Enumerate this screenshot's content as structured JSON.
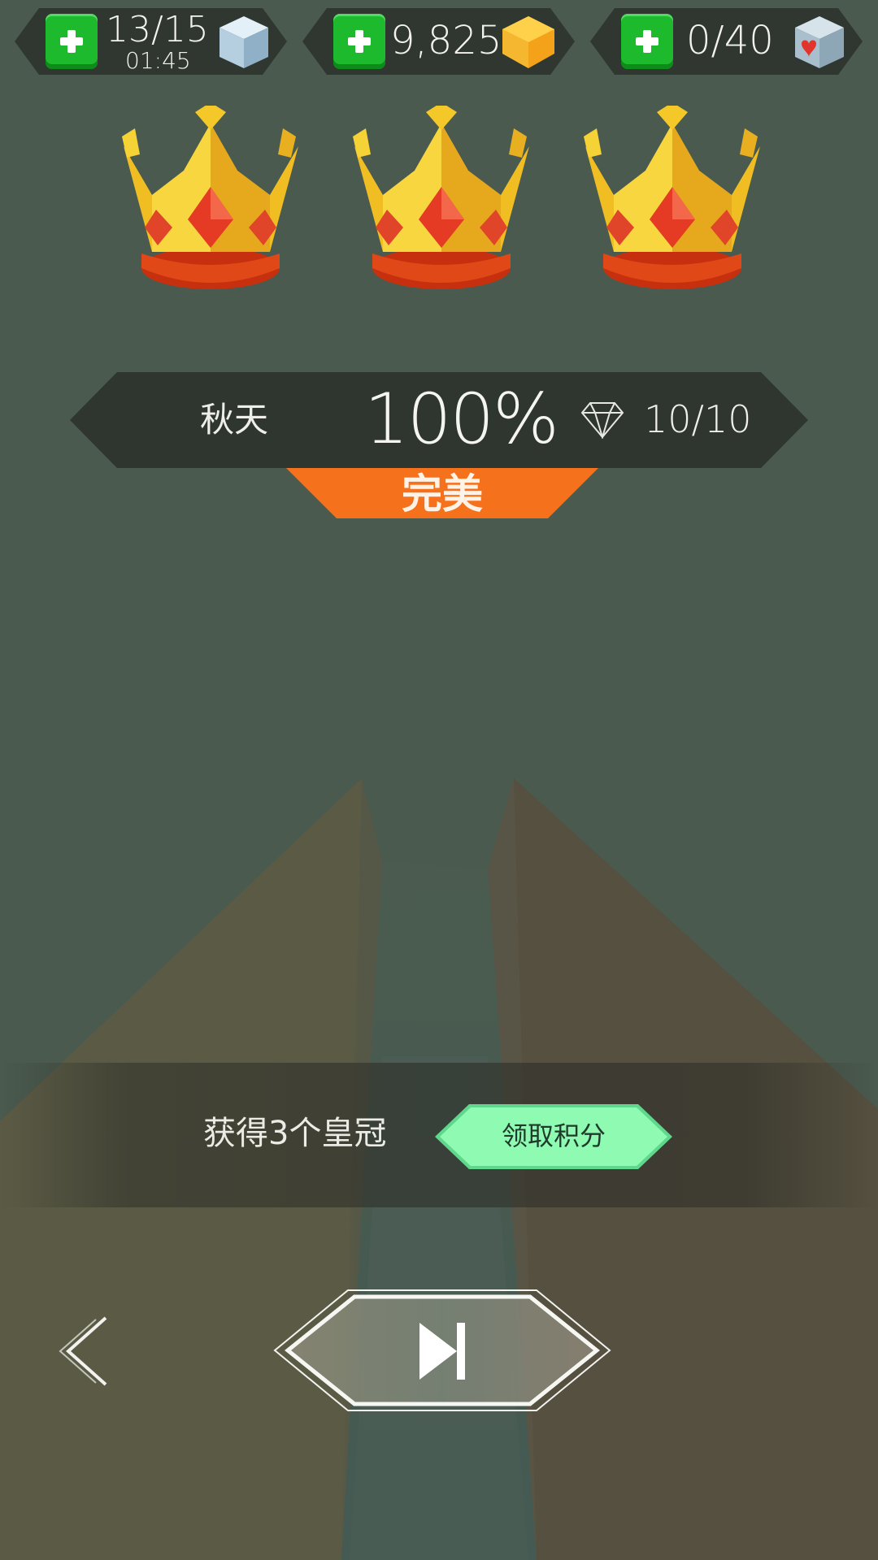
{
  "resources": {
    "energy": {
      "value": "13/15",
      "timer": "01:45",
      "icon": "ice-cube-icon"
    },
    "coins": {
      "value": "9,825",
      "icon": "gold-gem-icon"
    },
    "hearts": {
      "value": "0/40",
      "icon": "heart-cube-icon"
    }
  },
  "crowns": {
    "earned": 3,
    "total": 3,
    "icon": "gold-crown-icon"
  },
  "result": {
    "level_name": "秋天",
    "percent": "100%",
    "gems": "10/10",
    "grade": "完美"
  },
  "reward": {
    "message": "获得3个皇冠",
    "claim_label": "领取积分"
  },
  "nav": {
    "back_icon": "chevron-left-icon",
    "skip_icon": "skip-next-icon"
  },
  "colors": {
    "background": "#4a5a4e",
    "banner": "#2f3630",
    "grade_tab": "#f5711b",
    "claim_button": "#8ffbb2",
    "plus_button": "#1dba2e"
  }
}
